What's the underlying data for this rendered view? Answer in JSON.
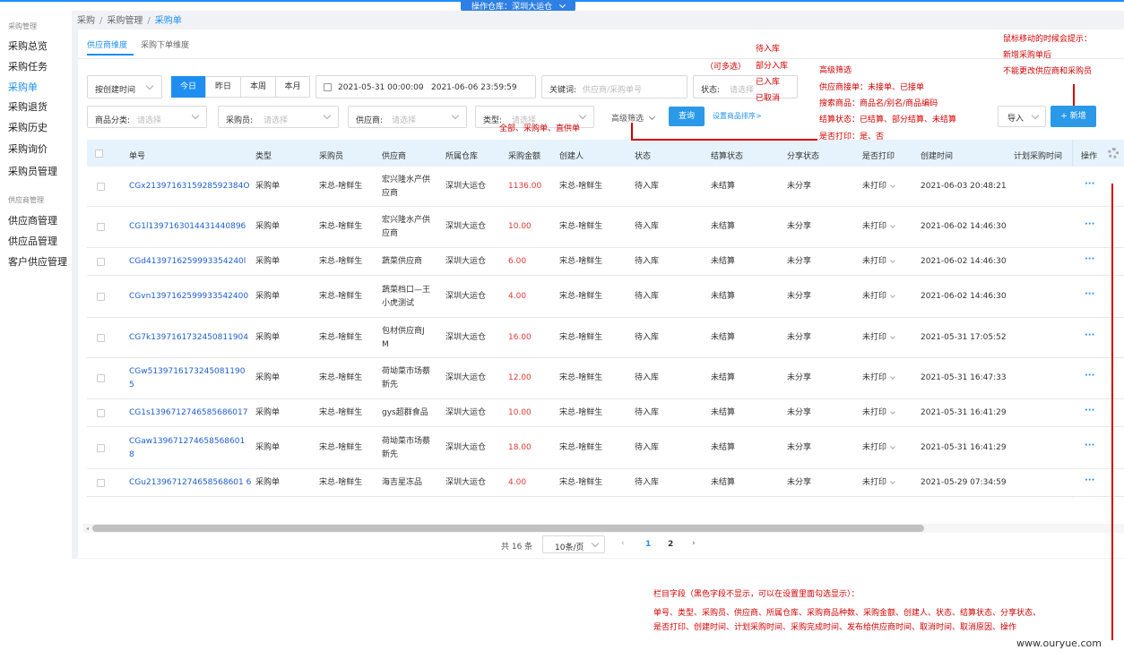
{
  "header": {
    "warehouse_label": "操作仓库：",
    "warehouse_name": "深圳大运仓"
  },
  "breadcrumb": {
    "l1": "采购",
    "l2": "采购管理",
    "l3": "采购单"
  },
  "sidebar": {
    "group1": "采购管理",
    "items1": [
      "采购总览",
      "采购任务",
      "采购单",
      "采购退货",
      "采购历史",
      "采购询价",
      "采购员管理"
    ],
    "group2": "供应商管理",
    "items2": [
      "供应商管理",
      "供应品管理",
      "客户供应管理"
    ]
  },
  "tabs": [
    "供应商维度",
    "采购下单维度"
  ],
  "filters": {
    "time_type": "按创建时间",
    "quick": [
      "今日",
      "昨日",
      "本周",
      "本月"
    ],
    "date_range_start": "2021-05-31 00:00:00",
    "date_range_sep": "-",
    "date_range_end": "2021-06-06 23:59:59",
    "keyword_label": "关键词:",
    "keyword_placeholder": "供应商/采购单号",
    "status_label": "状态:",
    "status_placeholder": "请选择",
    "category_label": "商品分类:",
    "category_placeholder": "请选择",
    "buyer_label": "采购员:",
    "buyer_placeholder": "请选择",
    "supplier_label": "供应商:",
    "supplier_placeholder": "请选择",
    "type_label": "类型:",
    "type_placeholder": "请选择",
    "advanced": "高级筛选",
    "query": "查询",
    "sort_link": "设置商品排序>",
    "import": "导入",
    "new": "+ 新增"
  },
  "table": {
    "columns": [
      "单号",
      "类型",
      "采购员",
      "供应商",
      "所属仓库",
      "采购金额",
      "创建人",
      "状态",
      "结算状态",
      "分享状态",
      "是否打印",
      "创建时间",
      "计划采购时间",
      "操作"
    ],
    "rows": [
      {
        "no": [
          "CGx2139716315928592384O"
        ],
        "type": "采购单",
        "buyer": "宋总-啥鲜生",
        "supplier": [
          "宏兴隆水产供",
          "应商"
        ],
        "wh": "深圳大运仓",
        "amount": "1136.00",
        "creator": "宋总-啥鲜生",
        "status": "待入库",
        "settle": "未结算",
        "share": "未分享",
        "print": "未打印",
        "created": "2021-06-03 20:48:21"
      },
      {
        "no": [
          "CG1l1397163014431440896"
        ],
        "type": "采购单",
        "buyer": "宋总-啥鲜生",
        "supplier": [
          "宏兴隆水产供",
          "应商"
        ],
        "wh": "深圳大运仓",
        "amount": "10.00",
        "creator": "宋总-啥鲜生",
        "status": "待入库",
        "settle": "未结算",
        "share": "未分享",
        "print": "未打印",
        "created": "2021-06-02 14:46:30"
      },
      {
        "no": [
          "CGd4139716259993354240l"
        ],
        "type": "采购单",
        "buyer": "宋总-啥鲜生",
        "supplier": [
          "蔬菜供应商"
        ],
        "wh": "深圳大运仓",
        "amount": "6.00",
        "creator": "宋总-啥鲜生",
        "status": "待入库",
        "settle": "未结算",
        "share": "未分享",
        "print": "未打印",
        "created": "2021-06-02 14:46:30"
      },
      {
        "no": [
          "CGvn1397162599933542400"
        ],
        "type": "采购单",
        "buyer": "宋总-啥鲜生",
        "supplier": [
          "蔬菜档口—王",
          "小虎测试"
        ],
        "wh": "深圳大运仓",
        "amount": "4.00",
        "creator": "宋总-啥鲜生",
        "status": "待入库",
        "settle": "未结算",
        "share": "未分享",
        "print": "未打印",
        "created": "2021-06-02 14:46:30"
      },
      {
        "no": [
          "CG7k1397161732450811904"
        ],
        "type": "采购单",
        "buyer": "宋总-啥鲜生",
        "supplier": [
          "包材供应商J",
          "M"
        ],
        "wh": "深圳大运仓",
        "amount": "16.00",
        "creator": "宋总-啥鲜生",
        "status": "待入库",
        "settle": "未结算",
        "share": "未分享",
        "print": "未打印",
        "created": "2021-05-31 17:05:52"
      },
      {
        "no": [
          "CGw5139716173245081190",
          "5"
        ],
        "type": "采购单",
        "buyer": "宋总-啥鲜生",
        "supplier": [
          "荷坳菜市场蔡",
          "新先"
        ],
        "wh": "深圳大运仓",
        "amount": "12.00",
        "creator": "宋总-啥鲜生",
        "status": "待入库",
        "settle": "未结算",
        "share": "未分享",
        "print": "未打印",
        "created": "2021-05-31 16:47:33"
      },
      {
        "no": [
          "CG1s1396712746585686017"
        ],
        "type": "采购单",
        "buyer": "宋总-啥鲜生",
        "supplier": [
          "gys超群食品"
        ],
        "wh": "深圳大运仓",
        "amount": "10.00",
        "creator": "宋总-啥鲜生",
        "status": "待入库",
        "settle": "未结算",
        "share": "未分享",
        "print": "未打印",
        "created": "2021-05-31 16:41:29"
      },
      {
        "no": [
          "CGaw139671274658568601",
          "8"
        ],
        "type": "采购单",
        "buyer": "宋总-啥鲜生",
        "supplier": [
          "荷坳菜市场蔡",
          "新先"
        ],
        "wh": "深圳大运仓",
        "amount": "18.00",
        "creator": "宋总-啥鲜生",
        "status": "待入库",
        "settle": "未结算",
        "share": "未分享",
        "print": "未打印",
        "created": "2021-05-31 16:41:29"
      },
      {
        "no": [
          "CGu2139671274658568601 6"
        ],
        "type": "采购单",
        "buyer": "宋总-啥鲜生",
        "supplier": [
          "海吉星冻品"
        ],
        "wh": "深圳大运仓",
        "amount": "4.00",
        "creator": "宋总-啥鲜生",
        "status": "待入库",
        "settle": "未结算",
        "share": "未分享",
        "print": "未打印",
        "created": "2021-05-29 07:34:59"
      }
    ]
  },
  "pagination": {
    "total": "共 16 条",
    "per_page": "10条/页",
    "pages": [
      "1",
      "2"
    ],
    "current": "1"
  },
  "annotations": {
    "hover_tip": [
      "鼠标移动的时候会提示：",
      "新增采购单后",
      "不能更改供应商和采购员"
    ],
    "status_options": [
      "待入库",
      "部分入库",
      "已入库",
      "已取消"
    ],
    "multi_select": "（可多选）",
    "type_options": "全部、采购单、直供单",
    "advanced": [
      "高级筛选",
      "供应商接单：未接单、已接单",
      "搜索商品：商品名/别名/商品编码",
      "结算状态：已结算、部分结算、未结算",
      "是否打印：是、否"
    ],
    "columns_note": [
      "栏目字段（黑色字段不显示，可以在设置里面勾选显示）：",
      "单号、类型、采购员、供应商、所属仓库、采购商品种数、采购金额、创建人、状态、结算状态、分享状态、",
      "是否打印、创建时间、计划采购时间、采购完成时间、发布给供应商时间、取消时间、取消原因、操作"
    ]
  },
  "watermark": "www.ouryue.com",
  "colors": {
    "primary": "#1e8ff0",
    "amount": "#e53935",
    "annotation": "#d40000"
  }
}
